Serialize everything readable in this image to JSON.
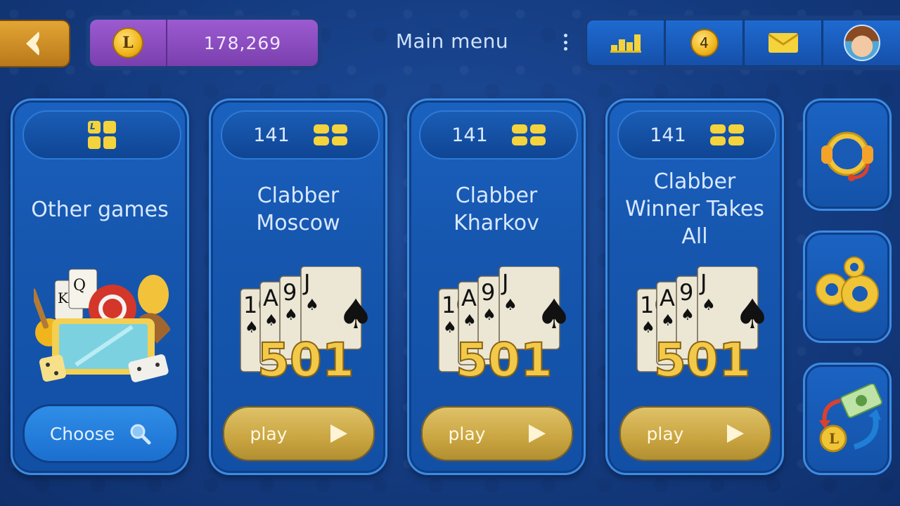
{
  "header": {
    "balance": "178,269",
    "coin_letter": "L",
    "title": "Main menu",
    "notifications_count": "4"
  },
  "cards": [
    {
      "title": "Other games",
      "button_label": "Choose"
    },
    {
      "count": "141",
      "title_line1": "Clabber",
      "title_line2": "Moscow",
      "button_label": "play",
      "art_number": "501"
    },
    {
      "count": "141",
      "title_line1": "Clabber",
      "title_line2": "Kharkov",
      "button_label": "play",
      "art_number": "501"
    },
    {
      "count": "141",
      "title_line1": "Clabber",
      "title_line2": "Winner Takes",
      "title_line3": "All",
      "button_label": "play",
      "art_number": "501"
    }
  ],
  "card_faces": [
    "10",
    "A",
    "9",
    "J"
  ],
  "colors": {
    "accent_gold": "#f4d33c",
    "balance_purple": "#9c5bd0",
    "play_gold": "#c9a440",
    "card_blue": "#1656ae"
  },
  "icons": {
    "back": "chevron-left-icon",
    "leaderboard": "bar-chart-icon",
    "messages": "envelope-icon",
    "support": "headset-icon",
    "settings": "gears-icon",
    "exchange": "currency-exchange-icon",
    "search": "search-icon"
  }
}
